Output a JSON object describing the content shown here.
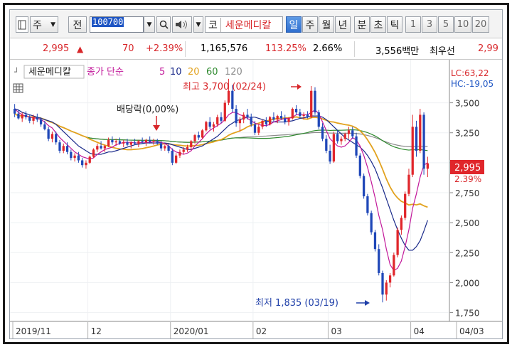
{
  "toolbar": {
    "market": "주",
    "chart_type": "전",
    "code": "100700",
    "stock_name": "세운메디칼",
    "prefix": "코",
    "periods": [
      "일",
      "주",
      "월",
      "년",
      "분",
      "초",
      "틱"
    ],
    "active_period": "일",
    "intervals": [
      "1",
      "3",
      "5",
      "10",
      "20"
    ]
  },
  "quote": {
    "price": "2,995",
    "arrow": "▲",
    "change": "70",
    "change_pct": "+2.39%",
    "volume": "1,165,576",
    "volume_ratio": "113.25%",
    "turnover": "2.66%",
    "amount": "3,556백만",
    "bid_label": "최우선",
    "bid_price": "2,99"
  },
  "legend": {
    "stock": "세운메디칼",
    "ma_label": "종가 단순",
    "periods": [
      "5",
      "10",
      "20",
      "60",
      "120"
    ],
    "colors": [
      "#c2189a",
      "#1a2a8a",
      "#e2a21e",
      "#2f8a2f",
      "#8c8c8c"
    ]
  },
  "colors": {
    "up": "#e0262b",
    "down": "#1f47b8",
    "accent": "#d8262a"
  },
  "chart_data": {
    "type": "candlestick",
    "title": "",
    "ylim": [
      1700,
      3800
    ],
    "y_ticks": [
      1750,
      2000,
      2250,
      2500,
      2750,
      3000,
      3250,
      3500
    ],
    "y_tick_labels": [
      "1,750",
      "2,000",
      "2,250",
      "2,500",
      "2,750",
      "3,000",
      "3,250",
      "3,500"
    ],
    "x_axis_labels": [
      {
        "label": "2019/11",
        "index": 0
      },
      {
        "label": "12",
        "index": 20
      },
      {
        "label": "2020/01",
        "index": 42
      },
      {
        "label": "02",
        "index": 64
      },
      {
        "label": "03",
        "index": 84
      },
      {
        "label": "04",
        "index": 106
      },
      {
        "label": "04/03",
        "index": 119
      }
    ],
    "candles": [
      [
        3450,
        3490,
        3380,
        3410
      ],
      [
        3410,
        3440,
        3360,
        3370
      ],
      [
        3370,
        3420,
        3340,
        3400
      ],
      [
        3400,
        3430,
        3360,
        3380
      ],
      [
        3380,
        3400,
        3330,
        3350
      ],
      [
        3350,
        3400,
        3320,
        3380
      ],
      [
        3380,
        3410,
        3340,
        3360
      ],
      [
        3360,
        3380,
        3300,
        3320
      ],
      [
        3320,
        3350,
        3270,
        3280
      ],
      [
        3280,
        3300,
        3180,
        3200
      ],
      [
        3200,
        3260,
        3170,
        3240
      ],
      [
        3240,
        3260,
        3150,
        3170
      ],
      [
        3170,
        3190,
        3080,
        3100
      ],
      [
        3100,
        3160,
        3080,
        3140
      ],
      [
        3140,
        3170,
        3070,
        3090
      ],
      [
        3090,
        3110,
        3020,
        3040
      ],
      [
        3040,
        3080,
        3010,
        3060
      ],
      [
        3060,
        3090,
        3000,
        3020
      ],
      [
        3020,
        3040,
        2960,
        2980
      ],
      [
        2980,
        3020,
        2950,
        3000
      ],
      [
        3000,
        3060,
        2990,
        3050
      ],
      [
        3050,
        3120,
        3040,
        3110
      ],
      [
        3110,
        3160,
        3090,
        3140
      ],
      [
        3140,
        3180,
        3110,
        3120
      ],
      [
        3120,
        3150,
        3090,
        3140
      ],
      [
        3140,
        3210,
        3130,
        3190
      ],
      [
        3190,
        3220,
        3150,
        3170
      ],
      [
        3170,
        3200,
        3140,
        3180
      ],
      [
        3180,
        3210,
        3150,
        3160
      ],
      [
        3160,
        3190,
        3130,
        3170
      ],
      [
        3170,
        3200,
        3140,
        3150
      ],
      [
        3150,
        3180,
        3120,
        3170
      ],
      [
        3170,
        3200,
        3150,
        3160
      ],
      [
        3160,
        3190,
        3130,
        3180
      ],
      [
        3180,
        3210,
        3160,
        3170
      ],
      [
        3170,
        3200,
        3140,
        3190
      ],
      [
        3190,
        3220,
        3160,
        3175
      ],
      [
        3175,
        3200,
        3150,
        3180
      ],
      [
        3180,
        3200,
        3150,
        3160
      ],
      [
        3160,
        3180,
        3100,
        3120
      ],
      [
        3120,
        3150,
        3100,
        3140
      ],
      [
        3140,
        3160,
        3080,
        3100
      ],
      [
        3100,
        3120,
        2980,
        3000
      ],
      [
        3000,
        3080,
        2990,
        3060
      ],
      [
        3060,
        3110,
        3040,
        3090
      ],
      [
        3090,
        3130,
        3070,
        3110
      ],
      [
        3110,
        3150,
        3090,
        3130
      ],
      [
        3130,
        3190,
        3110,
        3180
      ],
      [
        3180,
        3240,
        3160,
        3230
      ],
      [
        3230,
        3260,
        3190,
        3210
      ],
      [
        3210,
        3280,
        3200,
        3270
      ],
      [
        3270,
        3350,
        3260,
        3340
      ],
      [
        3340,
        3380,
        3280,
        3300
      ],
      [
        3300,
        3340,
        3260,
        3320
      ],
      [
        3320,
        3400,
        3300,
        3380
      ],
      [
        3380,
        3420,
        3330,
        3350
      ],
      [
        3350,
        3520,
        3340,
        3500
      ],
      [
        3500,
        3700,
        3480,
        3600
      ],
      [
        3600,
        3650,
        3420,
        3450
      ],
      [
        3450,
        3480,
        3300,
        3330
      ],
      [
        3330,
        3380,
        3260,
        3360
      ],
      [
        3360,
        3420,
        3330,
        3400
      ],
      [
        3400,
        3450,
        3360,
        3380
      ],
      [
        3380,
        3410,
        3300,
        3320
      ],
      [
        3320,
        3350,
        3230,
        3250
      ],
      [
        3250,
        3320,
        3230,
        3300
      ],
      [
        3300,
        3360,
        3280,
        3350
      ],
      [
        3350,
        3380,
        3300,
        3320
      ],
      [
        3320,
        3390,
        3310,
        3380
      ],
      [
        3380,
        3420,
        3340,
        3360
      ],
      [
        3360,
        3400,
        3330,
        3390
      ],
      [
        3390,
        3430,
        3360,
        3370
      ],
      [
        3370,
        3400,
        3320,
        3340
      ],
      [
        3340,
        3380,
        3310,
        3370
      ],
      [
        3370,
        3460,
        3360,
        3450
      ],
      [
        3450,
        3480,
        3400,
        3420
      ],
      [
        3420,
        3450,
        3370,
        3390
      ],
      [
        3390,
        3420,
        3360,
        3400
      ],
      [
        3400,
        3430,
        3370,
        3380
      ],
      [
        3380,
        3640,
        3370,
        3600
      ],
      [
        3600,
        3630,
        3400,
        3420
      ],
      [
        3420,
        3440,
        3280,
        3300
      ],
      [
        3300,
        3330,
        3180,
        3200
      ],
      [
        3200,
        3230,
        3080,
        3100
      ],
      [
        3100,
        3150,
        2990,
        3010
      ],
      [
        3010,
        3260,
        3000,
        3240
      ],
      [
        3240,
        3270,
        3160,
        3180
      ],
      [
        3180,
        3220,
        3150,
        3200
      ],
      [
        3200,
        3250,
        3180,
        3240
      ],
      [
        3240,
        3300,
        3200,
        3270
      ],
      [
        3270,
        3300,
        3200,
        3220
      ],
      [
        3220,
        3250,
        3040,
        3060
      ],
      [
        3060,
        3080,
        2870,
        2890
      ],
      [
        2890,
        2910,
        2700,
        2720
      ],
      [
        2720,
        2740,
        2560,
        2580
      ],
      [
        2580,
        2600,
        2400,
        2420
      ],
      [
        2420,
        2440,
        2260,
        2280
      ],
      [
        2280,
        2320,
        2060,
        2080
      ],
      [
        2080,
        2100,
        1835,
        1900
      ],
      [
        1900,
        2020,
        1850,
        2000
      ],
      [
        2000,
        2080,
        1960,
        2060
      ],
      [
        2060,
        2250,
        2050,
        2230
      ],
      [
        2230,
        2460,
        2210,
        2440
      ],
      [
        2440,
        2560,
        2400,
        2540
      ],
      [
        2540,
        2760,
        2520,
        2740
      ],
      [
        2740,
        2950,
        2720,
        2900
      ],
      [
        2900,
        3400,
        2880,
        3300
      ],
      [
        3300,
        3350,
        3050,
        3100
      ],
      [
        3100,
        3450,
        3080,
        3400
      ],
      [
        3400,
        3420,
        2900,
        2950
      ],
      [
        2950,
        3050,
        2880,
        2995
      ]
    ],
    "moving_averages": {
      "ma5": [
        3450,
        3420,
        3400,
        3390,
        3380,
        3375,
        3370,
        3360,
        3340,
        3310,
        3290,
        3250,
        3210,
        3180,
        3150,
        3120,
        3090,
        3070,
        3050,
        3040,
        3030,
        3040,
        3070,
        3090,
        3110,
        3120,
        3130,
        3150,
        3160,
        3170,
        3170,
        3170,
        3165,
        3165,
        3170,
        3170,
        3170,
        3175,
        3175,
        3170,
        3160,
        3140,
        3110,
        3090,
        3080,
        3070,
        3080,
        3100,
        3140,
        3170,
        3200,
        3240,
        3270,
        3290,
        3310,
        3330,
        3360,
        3400,
        3420,
        3420,
        3400,
        3390,
        3370,
        3350,
        3330,
        3320,
        3310,
        3310,
        3320,
        3340,
        3350,
        3360,
        3370,
        3370,
        3380,
        3400,
        3400,
        3400,
        3400,
        3420,
        3440,
        3410,
        3340,
        3270,
        3200,
        3170,
        3140,
        3130,
        3140,
        3170,
        3210,
        3190,
        3140,
        3060,
        2960,
        2840,
        2710,
        2560,
        2440,
        2280,
        2150,
        2100,
        2120,
        2180,
        2300,
        2440,
        2620,
        2740,
        2880,
        2980,
        3000
      ],
      "ma10": [
        3450,
        3440,
        3420,
        3410,
        3400,
        3390,
        3380,
        3370,
        3360,
        3350,
        3340,
        3320,
        3290,
        3260,
        3230,
        3200,
        3170,
        3140,
        3120,
        3100,
        3080,
        3070,
        3070,
        3070,
        3080,
        3090,
        3090,
        3100,
        3110,
        3120,
        3130,
        3140,
        3150,
        3155,
        3160,
        3165,
        3165,
        3165,
        3165,
        3165,
        3165,
        3160,
        3150,
        3140,
        3130,
        3120,
        3110,
        3110,
        3120,
        3130,
        3140,
        3160,
        3180,
        3200,
        3220,
        3250,
        3280,
        3310,
        3330,
        3350,
        3360,
        3370,
        3380,
        3380,
        3380,
        3370,
        3360,
        3350,
        3340,
        3340,
        3340,
        3340,
        3340,
        3345,
        3350,
        3360,
        3370,
        3375,
        3380,
        3390,
        3390,
        3390,
        3380,
        3360,
        3330,
        3300,
        3270,
        3240,
        3210,
        3190,
        3170,
        3150,
        3130,
        3100,
        3060,
        3010,
        2950,
        2870,
        2790,
        2700,
        2610,
        2520,
        2440,
        2370,
        2310,
        2270,
        2270,
        2300,
        2350,
        2430,
        2520
      ]
    },
    "annotations": {
      "high": "최고 3,700 (02/24)",
      "low": "최저 1,835 (03/19)",
      "dividend": "배당락(0,00%)"
    },
    "right_labels": {
      "lc": "LC:63,22",
      "hc": "HC:-19,05",
      "price_tag": "2,995",
      "pct_tag": "2.39%"
    }
  }
}
